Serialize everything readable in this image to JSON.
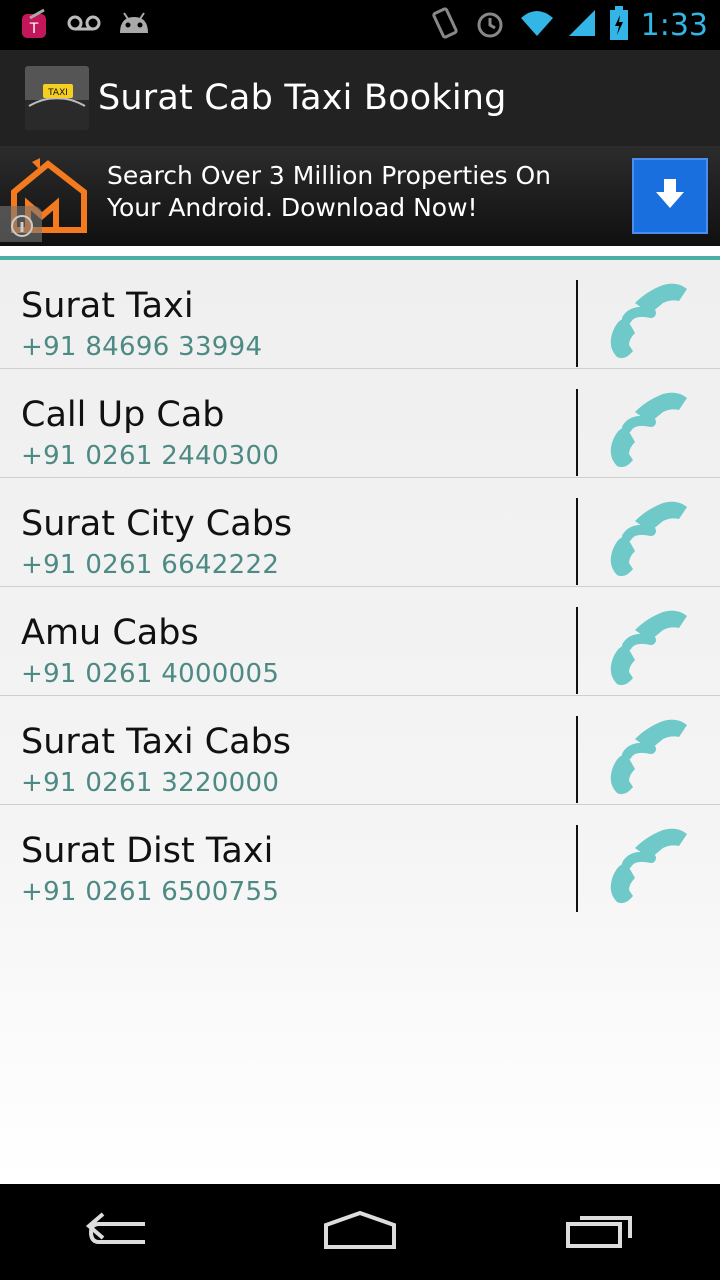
{
  "status_bar": {
    "time": "1:33",
    "icons": [
      "tmobile-icon",
      "voicemail-icon",
      "android-icon",
      "vibrate-icon",
      "alarm-icon",
      "wifi-icon",
      "signal-icon",
      "battery-charging-icon"
    ]
  },
  "action_bar": {
    "title": "Surat Cab Taxi Booking"
  },
  "ad": {
    "text": "Search Over 3 Million Properties On Your Android. Download Now!",
    "download_icon": "download-arrow-icon"
  },
  "contacts": [
    {
      "name": "Surat Taxi",
      "phone": "+91 84696 33994"
    },
    {
      "name": "Call Up Cab",
      "phone": "+91 0261 2440300"
    },
    {
      "name": "Surat City Cabs",
      "phone": "+91 0261 6642222"
    },
    {
      "name": "Amu Cabs",
      "phone": "+91 0261 4000005"
    },
    {
      "name": "Surat Taxi Cabs",
      "phone": "+91 0261 3220000"
    },
    {
      "name": "Surat Dist Taxi",
      "phone": "+91 0261 6500755"
    }
  ],
  "colors": {
    "accent": "#4ab0a6",
    "phone_text": "#4d8a84",
    "call_icon": "#6fc9c9",
    "clock": "#33b5e5",
    "ad_button": "#1a6fde"
  },
  "nav_bar": {
    "icons": [
      "back-icon",
      "home-icon",
      "recent-apps-icon"
    ]
  }
}
